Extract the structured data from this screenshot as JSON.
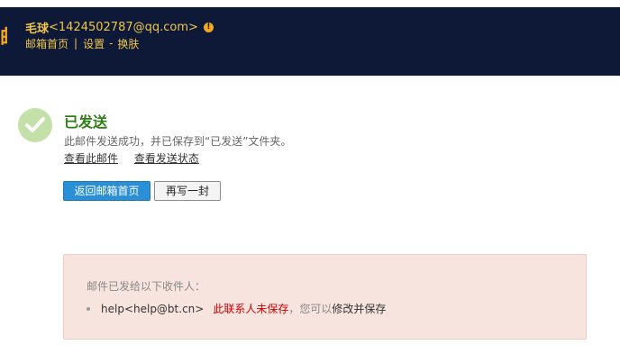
{
  "header": {
    "user_name": "毛球",
    "user_email": "<1424502787@qq.com>",
    "warning_icon": "!",
    "links": {
      "mailbox_home": "邮箱首页",
      "separator": "|",
      "settings": "设置",
      "dash": "-",
      "change_skin": "换肤"
    }
  },
  "result": {
    "title": "已发送",
    "description": "此邮件发送成功，并已保存到“已发送”文件夹。",
    "view_mail": "查看此邮件",
    "view_status": "查看发送状态"
  },
  "buttons": {
    "back_home": "返回邮箱首页",
    "write_again": "再写一封"
  },
  "notice": {
    "title": "邮件已发给以下收件人：",
    "recipient": "help<help@bt.cn>",
    "unsaved_label": "此联系人未保存",
    "hint": "，您可以",
    "edit_save": "修改并保存"
  },
  "colors": {
    "header_bg": "#0d1936",
    "header_text": "#f0c64a",
    "success_green": "#2e7d16",
    "primary_button": "#2a8fd4",
    "notice_bg": "#f7e4df",
    "alert_red": "#c00"
  }
}
